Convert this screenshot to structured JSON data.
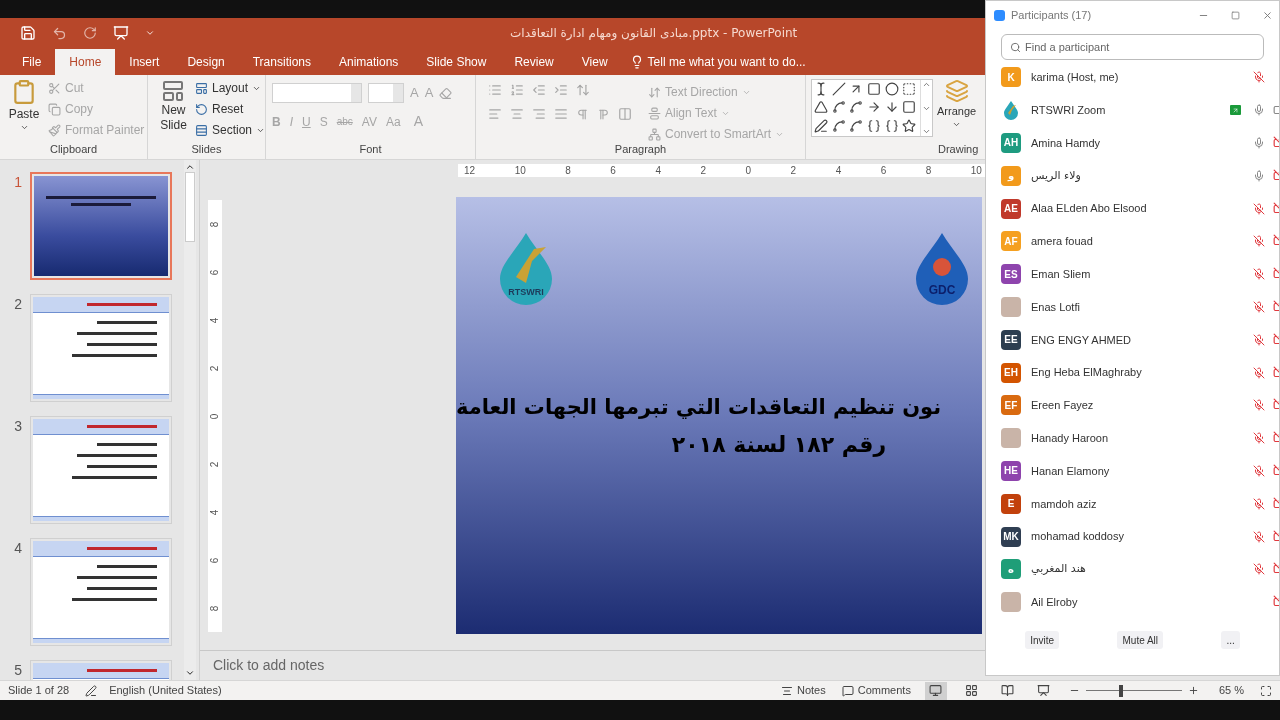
{
  "title_bar": {
    "title": "مبادى القانون ومهام ادارة التعاقدات.pptx - PowerPoint"
  },
  "tabs": [
    {
      "label": "File",
      "selected": false
    },
    {
      "label": "Home",
      "selected": true
    },
    {
      "label": "Insert",
      "selected": false
    },
    {
      "label": "Design",
      "selected": false
    },
    {
      "label": "Transitions",
      "selected": false
    },
    {
      "label": "Animations",
      "selected": false
    },
    {
      "label": "Slide Show",
      "selected": false
    },
    {
      "label": "Review",
      "selected": false
    },
    {
      "label": "View",
      "selected": false
    }
  ],
  "tell_me": {
    "placeholder": "Tell me what you want to do..."
  },
  "ribbon": {
    "clipboard": {
      "label": "Clipboard",
      "paste": "Paste",
      "items": [
        {
          "label": "Cut",
          "kind": "cut",
          "disabled": true
        },
        {
          "label": "Copy",
          "kind": "copy",
          "disabled": true
        },
        {
          "label": "Format Painter",
          "kind": "painter",
          "disabled": true
        }
      ]
    },
    "slides": {
      "label": "Slides",
      "new_slide": "New Slide",
      "items": [
        {
          "label": "Layout",
          "kind": "layout",
          "dropdown": true
        },
        {
          "label": "Reset",
          "kind": "reset",
          "dropdown": false
        },
        {
          "label": "Section",
          "kind": "section",
          "dropdown": true
        }
      ]
    },
    "font": {
      "label": "Font",
      "disabled": true,
      "size_buttons": [
        "A",
        "A"
      ],
      "format_buttons": [
        "B",
        "I",
        "U",
        "S",
        "abc",
        "AV",
        "Aa"
      ],
      "color_button": "A"
    },
    "paragraph": {
      "label": "Paragraph",
      "disabled": true,
      "items": [
        {
          "label": "Text Direction",
          "kind": "direction"
        },
        {
          "label": "Align Text",
          "kind": "align"
        },
        {
          "label": "Convert to SmartArt",
          "kind": "smartart"
        }
      ]
    },
    "drawing": {
      "label": "Drawing",
      "arrange": "Arrange"
    }
  },
  "thumbnails": [
    {
      "number": "1",
      "kind": "title",
      "selected": true
    },
    {
      "number": "2",
      "kind": "content",
      "selected": false
    },
    {
      "number": "3",
      "kind": "content",
      "selected": false
    },
    {
      "number": "4",
      "kind": "content",
      "selected": false
    },
    {
      "number": "5",
      "kind": "content",
      "selected": false
    }
  ],
  "ruler": {
    "horizontal": [
      "12",
      "10",
      "8",
      "6",
      "4",
      "2",
      "0",
      "2",
      "4",
      "6",
      "8",
      "10"
    ],
    "vertical": [
      "8",
      "6",
      "4",
      "2",
      "0",
      "2",
      "4",
      "6",
      "8"
    ]
  },
  "slide": {
    "logos": [
      "RTSWRI",
      "GDC"
    ],
    "title_lines": [
      "نون تنظيم التعاقدات التي تبرمها الجهات العامة",
      "رقم ١٨٢ لسنة ٢٠١٨"
    ]
  },
  "notes": {
    "placeholder": "Click to add notes"
  },
  "status_bar": {
    "slide": "Slide 1 of 28",
    "language": "English (United States)",
    "notes": "Notes",
    "comments": "Comments",
    "views": [
      {
        "kind": "normal",
        "selected": true
      },
      {
        "kind": "sorter",
        "selected": false
      },
      {
        "kind": "reading",
        "selected": false
      },
      {
        "kind": "show",
        "selected": false
      }
    ],
    "zoom": {
      "level": 0.34,
      "reading": "65 %"
    }
  },
  "participants_window": {
    "title": "Participants (17)",
    "search": {
      "placeholder": "Find a participant"
    },
    "participants": [
      {
        "name": "karima (Host, me)",
        "kind": "initials",
        "initials": "K",
        "color": "#f29a1b",
        "share": false,
        "mic": {
          "muted": true
        }
      },
      {
        "name": "RTSWRI Zoom",
        "kind": "logo",
        "share": true,
        "mic": {
          "muted": false
        },
        "video": {
          "on": true
        }
      },
      {
        "name": "Amina Hamdy",
        "kind": "initials",
        "initials": "AH",
        "color": "#1e9b80",
        "share": false,
        "mic": {
          "muted": false
        },
        "video": {
          "on": false
        }
      },
      {
        "name": "ولاء الريس",
        "kind": "initials",
        "initials": "و",
        "color": "#f29a1b",
        "share": false,
        "mic": {
          "muted": false
        },
        "video": {
          "on": false
        }
      },
      {
        "name": "Alaa ELden Abo Elsood",
        "kind": "initials",
        "initials": "AE",
        "color": "#c0392b",
        "share": false,
        "mic": {
          "muted": true
        },
        "video": {
          "on": false
        }
      },
      {
        "name": "amera fouad",
        "kind": "initials",
        "initials": "AF",
        "color": "#f5a020",
        "share": false,
        "mic": {
          "muted": true
        },
        "video": {
          "on": false
        }
      },
      {
        "name": "Eman Sliem",
        "kind": "initials",
        "initials": "ES",
        "color": "#8e44ad",
        "share": false,
        "mic": {
          "muted": true
        },
        "video": {
          "on": false
        }
      },
      {
        "name": "Enas Lotfi",
        "kind": "photo",
        "share": false,
        "mic": {
          "muted": true
        },
        "video": {
          "on": false
        }
      },
      {
        "name": "ENG ENGY AHMED",
        "kind": "initials",
        "initials": "EE",
        "color": "#2c3e50",
        "share": false,
        "mic": {
          "muted": true
        },
        "video": {
          "on": false
        }
      },
      {
        "name": "Eng Heba ElMaghraby",
        "kind": "initials",
        "initials": "EH",
        "color": "#d35400",
        "share": false,
        "mic": {
          "muted": true
        },
        "video": {
          "on": false
        }
      },
      {
        "name": "Ereen Fayez",
        "kind": "initials",
        "initials": "EF",
        "color": "#d96a10",
        "share": false,
        "mic": {
          "muted": true
        },
        "video": {
          "on": false
        }
      },
      {
        "name": "Hanady Haroon",
        "kind": "photo",
        "share": false,
        "mic": {
          "muted": true
        },
        "video": {
          "on": false
        }
      },
      {
        "name": "Hanan Elamony",
        "kind": "initials",
        "initials": "HE",
        "color": "#8e44ad",
        "share": false,
        "mic": {
          "muted": true
        },
        "video": {
          "on": false
        }
      },
      {
        "name": "mamdoh aziz",
        "kind": "initials",
        "initials": "E",
        "color": "#c2410c",
        "share": false,
        "mic": {
          "muted": true
        },
        "video": {
          "on": false
        }
      },
      {
        "name": "mohamad koddosy",
        "kind": "initials",
        "initials": "MK",
        "color": "#2f3e52",
        "share": false,
        "mic": {
          "muted": true
        },
        "video": {
          "on": false
        }
      },
      {
        "name": "هند المغربي",
        "kind": "initials",
        "initials": "ه",
        "color": "#1f9e78",
        "share": false,
        "mic": {
          "muted": true
        },
        "video": {
          "on": false
        }
      },
      {
        "name": "Ail Elroby",
        "kind": "photo",
        "share": false,
        "video": {
          "on": false
        }
      }
    ],
    "buttons": [
      "Invite",
      "Mute All",
      "..."
    ]
  }
}
